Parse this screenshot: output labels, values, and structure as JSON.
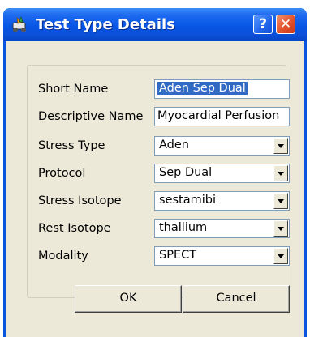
{
  "window": {
    "title": "Test Type Details",
    "help_glyph": "?",
    "close_glyph": "✕"
  },
  "fields": [
    {
      "label": "Short Name",
      "type": "text",
      "value": "Aden Sep Dual"
    },
    {
      "label": "Descriptive Name",
      "type": "text",
      "value": "Myocardial Perfusion"
    },
    {
      "label": "Stress Type",
      "type": "select",
      "value": "Aden"
    },
    {
      "label": "Protocol",
      "type": "select",
      "value": "Sep Dual"
    },
    {
      "label": "Stress Isotope",
      "type": "select",
      "value": "sestamibi"
    },
    {
      "label": "Rest Isotope",
      "type": "select",
      "value": "thallium"
    },
    {
      "label": "Modality",
      "type": "select",
      "value": "SPECT"
    }
  ],
  "buttons": {
    "ok": "OK",
    "cancel": "Cancel"
  }
}
